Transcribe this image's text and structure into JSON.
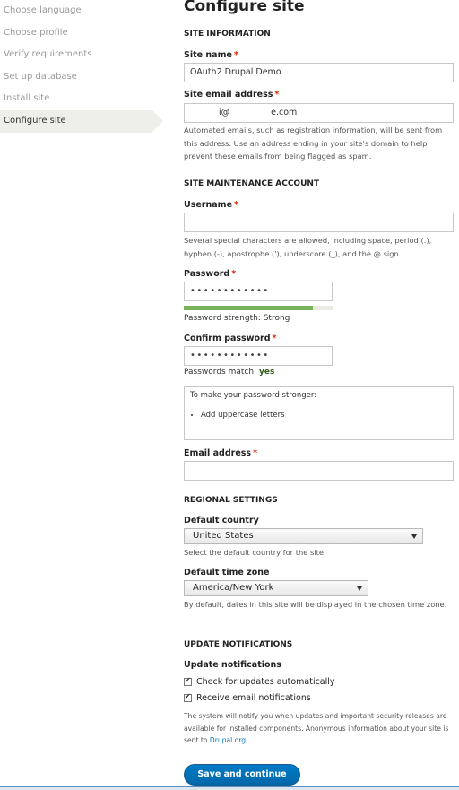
{
  "sidebar": {
    "steps": [
      {
        "label": "Choose language"
      },
      {
        "label": "Choose profile"
      },
      {
        "label": "Verify requirements"
      },
      {
        "label": "Set up database"
      },
      {
        "label": "Install site"
      },
      {
        "label": "Configure site"
      }
    ],
    "active_index": 5
  },
  "page": {
    "title": "Configure site"
  },
  "site_information": {
    "title": "SITE INFORMATION",
    "site_name": {
      "label": "Site name",
      "value": "OAuth2 Drupal Demo"
    },
    "site_email": {
      "label": "Site email address",
      "value_prefix": "i@",
      "value_suffix": "e.com",
      "description": "Automated emails, such as registration information, will be sent from this address. Use an address ending in your site's domain to help prevent these emails from being flagged as spam."
    }
  },
  "maintenance": {
    "title": "SITE MAINTENANCE ACCOUNT",
    "username": {
      "label": "Username",
      "value": "",
      "description": "Several special characters are allowed, including space, period (.), hyphen (-), apostrophe ('), underscore (_), and the @ sign."
    },
    "password": {
      "label": "Password",
      "dots": "••••••••••••",
      "strength_text": "Password strength: Strong",
      "strength_fraction": 0.87
    },
    "confirm_password": {
      "label": "Confirm password",
      "dots": "••••••••••••",
      "match_text": "Passwords match:",
      "match_value": "yes"
    },
    "tips": {
      "title": "To make your password stronger:",
      "items": [
        "Add uppercase letters"
      ]
    },
    "email": {
      "label": "Email address",
      "value": ""
    }
  },
  "regional": {
    "title": "REGIONAL SETTINGS",
    "country": {
      "label": "Default country",
      "value": "United States",
      "description": "Select the default country for the site."
    },
    "timezone": {
      "label": "Default time zone",
      "value": "America/New York",
      "description": "By default, dates in this site will be displayed in the chosen time zone."
    }
  },
  "updates": {
    "title": "UPDATE NOTIFICATIONS",
    "group_label": "Update notifications",
    "check_auto": {
      "label": "Check for updates automatically",
      "checked": true
    },
    "email_notify": {
      "label": "Receive email notifications",
      "checked": true
    },
    "description_main": "The system will notify you when updates and important security releases are available for installed components. Anonymous information about your site is sent to",
    "description_link": "Drupal.org",
    "description_end": "."
  },
  "actions": {
    "save_label": "Save and continue"
  },
  "colors": {
    "required": "#e32700",
    "button": "#0071b8",
    "strength": "#77b259",
    "link": "#0074bd"
  }
}
